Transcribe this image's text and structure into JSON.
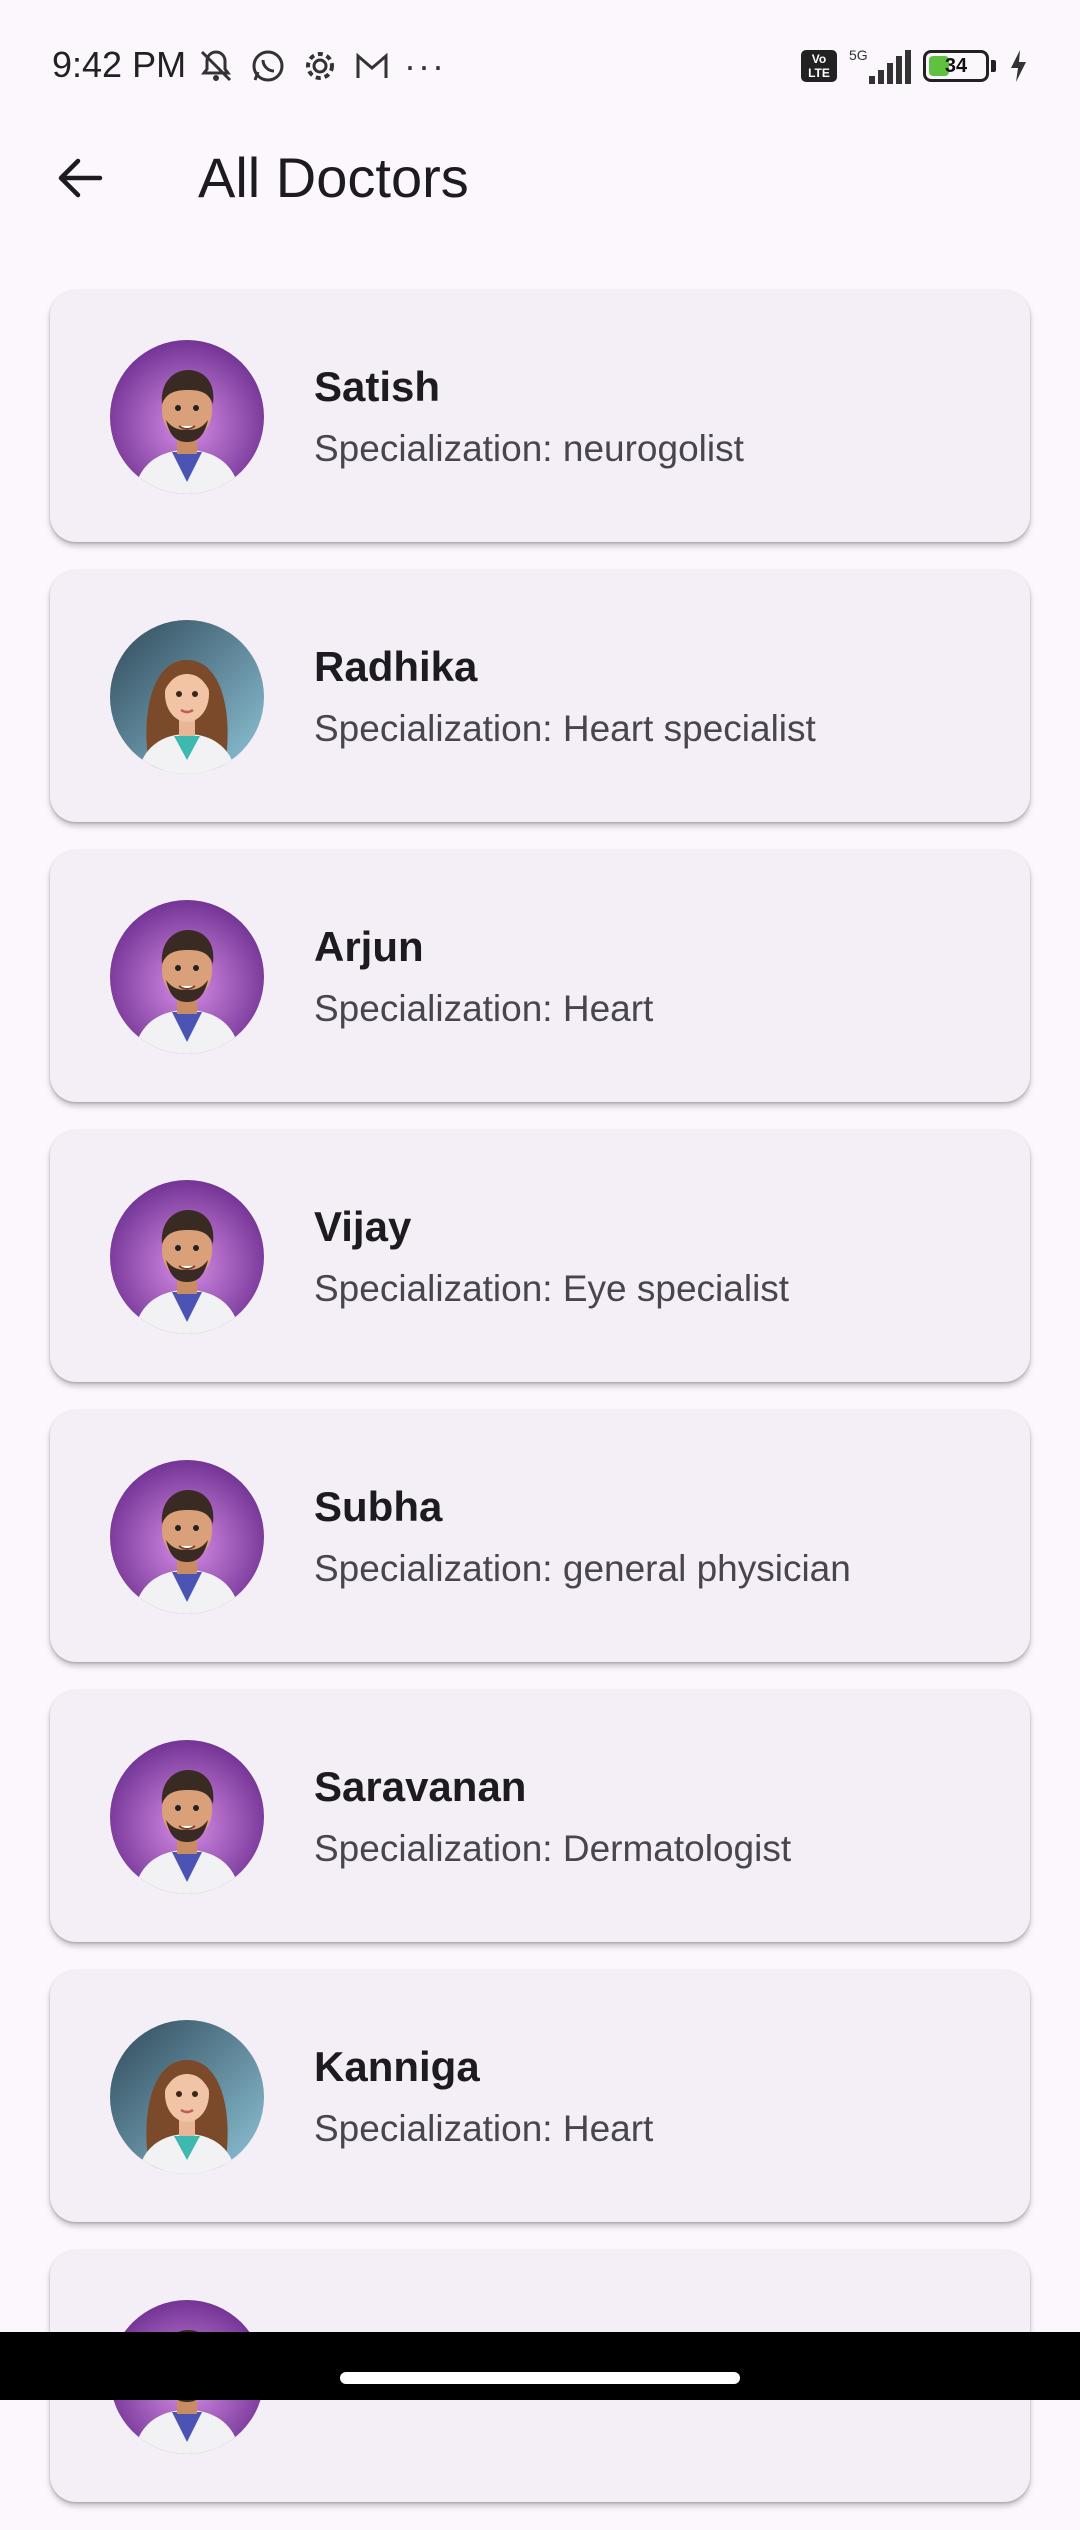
{
  "status_bar": {
    "time": "9:42 PM",
    "left_icons": [
      "mute-icon",
      "whatsapp-icon",
      "settings-icon",
      "gmail-icon",
      "more-dots-icon"
    ],
    "volte_label": "Vo LTE",
    "network": "5G",
    "battery_level": "34"
  },
  "app_bar": {
    "back_icon": "arrow-left-icon",
    "title": "All Doctors"
  },
  "doctors": [
    {
      "name": "Satish",
      "specialization": "Specialization: neurogolist",
      "avatar": "male"
    },
    {
      "name": "Radhika",
      "specialization": "Specialization: Heart specialist",
      "avatar": "female"
    },
    {
      "name": "Arjun",
      "specialization": "Specialization: Heart",
      "avatar": "male"
    },
    {
      "name": "Vijay",
      "specialization": "Specialization: Eye specialist",
      "avatar": "male"
    },
    {
      "name": "Subha",
      "specialization": "Specialization: general physician",
      "avatar": "male"
    },
    {
      "name": "Saravanan",
      "specialization": "Specialization: Dermatologist",
      "avatar": "male"
    },
    {
      "name": "Kanniga",
      "specialization": "Specialization: Heart",
      "avatar": "female"
    },
    {
      "name": "",
      "specialization": "",
      "avatar": "male"
    }
  ],
  "colors": {
    "background": "#fcf7fd",
    "card": "#f4eff6",
    "male_avatar_bg": "#8e44ad",
    "female_avatar_bg": "#5b8fa8"
  }
}
